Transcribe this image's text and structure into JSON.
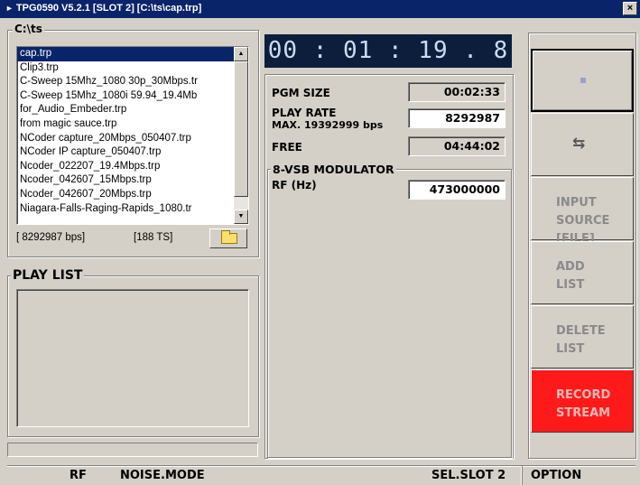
{
  "window": {
    "title": "TPG0590 V5.2.1 [SLOT 2] [C:\\ts\\cap.trp]",
    "title_icon": "play-triangle-icon",
    "close_label": "×"
  },
  "files": {
    "group_label": "C:\\ts",
    "items": [
      "cap.trp",
      "Clip3.trp",
      "C-Sweep 15Mhz_1080 30p_30Mbps.tr",
      "C-Sweep 15Mhz_1080i 59.94_19.4Mb",
      "for_Audio_Embeder.trp",
      "from magic sauce.trp",
      "NCoder capture_20Mbps_050407.trp",
      "NCoder IP capture_050407.trp",
      "Ncoder_022207_19.4Mbps.trp",
      "Ncoder_042607_15Mbps.trp",
      "Ncoder_042607_20Mbps.trp",
      "Niagara-Falls-Raging-Rapids_1080.tr"
    ],
    "selected_index": 0,
    "bitrate_text": "[ 8292987 bps]",
    "ts_text": "[188 TS]",
    "folder_icon": "folder-icon"
  },
  "playlist": {
    "group_label": "PLAY LIST"
  },
  "timer": {
    "value": "00 : 01 : 19 . 8"
  },
  "stream": {
    "pgm_size_label": "PGM SIZE",
    "pgm_size_value": "00:02:33",
    "play_rate_label": "PLAY RATE",
    "play_rate_value": "8292987",
    "max_label": "MAX. 19392999 bps",
    "free_label": "FREE",
    "free_value": "04:44:02"
  },
  "modulator": {
    "group_label": "8-VSB MODULATOR",
    "rf_label": "RF (Hz)",
    "rf_value": "473000000"
  },
  "buttons": {
    "stop_icon": "stop-icon",
    "loop_icon": "loop-icon",
    "loop_glyph": "⇆",
    "input_source": "INPUT\nSOURCE\n[FILE]",
    "add_list": "ADD\nLIST",
    "delete_list": "DELETE\nLIST",
    "record_stream": "RECORD\nSTREAM"
  },
  "status_bar": {
    "rf": "RF",
    "noise_mode": "NOISE.MODE",
    "sel_slot": "SEL.SLOT 2",
    "option": "OPTION"
  }
}
